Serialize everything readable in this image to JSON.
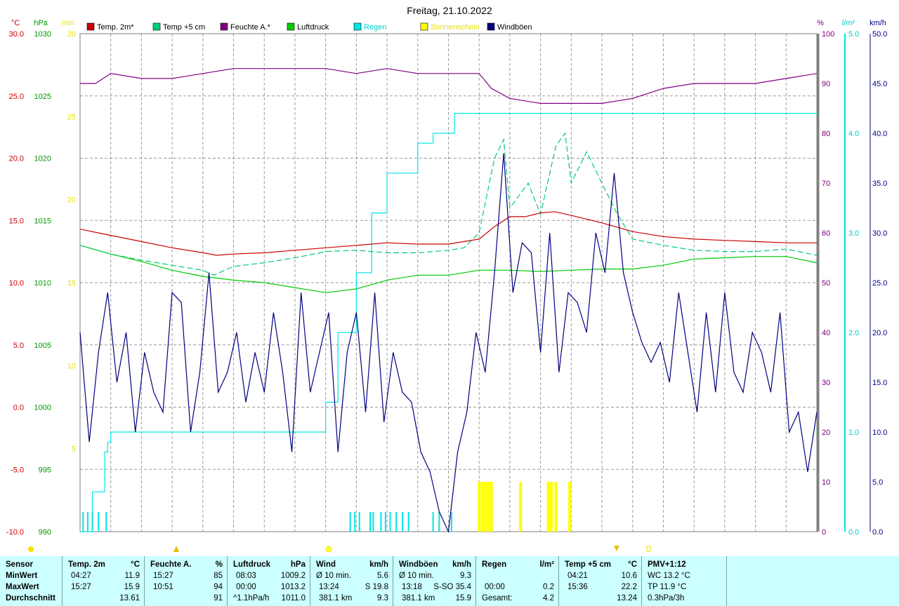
{
  "chart_data": {
    "type": "line",
    "title": "Freitag, 21.10.2022",
    "legend": [
      {
        "name": "Temp. 2m*",
        "color": "#cc0000"
      },
      {
        "name": "Temp +5 cm",
        "color": "#00cc77"
      },
      {
        "name": "Feuchte A.*",
        "color": "#800080"
      },
      {
        "name": "Luftdruck",
        "color": "#00cc00"
      },
      {
        "name": "Regen",
        "color": "#00e5e5"
      },
      {
        "name": "Sonnenschein",
        "color": "#ffff00"
      },
      {
        "name": "Windböen",
        "color": "#000080"
      }
    ],
    "axes": {
      "temp": {
        "unit": "°C",
        "color": "#cc0000",
        "range": [
          -10,
          30
        ],
        "ticks": [
          "30.0",
          "25.0",
          "20.0",
          "15.0",
          "10.0",
          "5.0",
          "0.0",
          "-5.0",
          "-10.0"
        ]
      },
      "pressure": {
        "unit": "hPa",
        "color": "#009900",
        "range": [
          990,
          1030
        ],
        "ticks": [
          "1030",
          "1025",
          "1020",
          "1015",
          "1010",
          "1005",
          "1000",
          "995",
          "990"
        ]
      },
      "sun": {
        "unit": "min",
        "color": "#e5e500",
        "range": [
          0,
          30
        ],
        "ticks": [
          "30",
          "25",
          "20",
          "15",
          "10",
          "5"
        ]
      },
      "humidity": {
        "unit": "%",
        "color": "#800080",
        "range": [
          0,
          100
        ],
        "ticks": [
          "100",
          "90",
          "80",
          "70",
          "60",
          "50",
          "40",
          "30",
          "20",
          "10",
          "0"
        ]
      },
      "rain": {
        "unit": "l/m²",
        "color": "#00cccc",
        "range": [
          0,
          5
        ],
        "ticks": [
          "5.0",
          "4.0",
          "3.0",
          "2.0",
          "1.0",
          "0.0"
        ]
      },
      "wind": {
        "unit": "km/h",
        "color": "#000080",
        "range": [
          0,
          50
        ],
        "ticks": [
          "50.0",
          "45.0",
          "40.0",
          "35.0",
          "30.0",
          "25.0",
          "20.0",
          "15.0",
          "10.0",
          "5.0",
          "0.0"
        ]
      }
    },
    "x_range_hours": [
      0,
      24
    ],
    "grid": true,
    "series": {
      "temp2m": {
        "axis": "temp",
        "x": [
          0,
          1,
          2,
          3,
          4,
          4.45,
          5,
          6,
          7,
          8,
          9,
          10,
          11,
          12,
          13,
          13.5,
          14,
          14.5,
          15,
          15.45,
          16,
          17,
          18,
          19,
          20,
          21,
          22,
          23,
          24
        ],
        "values": [
          14.3,
          13.8,
          13.3,
          12.8,
          12.4,
          12.2,
          12.3,
          12.4,
          12.6,
          12.8,
          13.0,
          13.2,
          13.1,
          13.1,
          13.5,
          14.5,
          15.3,
          15.3,
          15.6,
          15.7,
          15.4,
          14.8,
          14.1,
          13.7,
          13.5,
          13.4,
          13.3,
          13.2,
          13.2
        ]
      },
      "temp5cm": {
        "axis": "temp",
        "x": [
          0,
          1,
          2,
          3,
          4,
          4.35,
          5,
          6,
          7,
          8,
          9,
          10,
          11,
          12,
          12.5,
          13,
          13.5,
          13.8,
          14,
          14.3,
          14.6,
          15,
          15.5,
          15.8,
          16,
          16.5,
          17,
          17.5,
          18,
          19,
          20,
          21,
          22,
          23,
          24
        ],
        "values": [
          13.0,
          12.3,
          11.8,
          11.4,
          11.0,
          10.6,
          11.3,
          11.6,
          12.0,
          12.5,
          12.6,
          12.4,
          12.4,
          12.6,
          12.8,
          14.0,
          20.0,
          21.5,
          16.0,
          17.0,
          18.0,
          15.5,
          21.0,
          22.0,
          18.0,
          20.5,
          18.0,
          15.5,
          13.5,
          13.0,
          12.6,
          12.5,
          12.5,
          12.7,
          12.2
        ]
      },
      "humidity": {
        "axis": "humidity",
        "x": [
          0,
          0.5,
          1,
          2,
          3,
          4,
          5,
          6,
          7,
          8,
          9,
          10,
          11,
          12,
          13,
          13.4,
          14,
          15,
          16,
          17,
          18,
          19,
          20,
          21,
          22,
          23,
          24
        ],
        "values": [
          90,
          90,
          92,
          91,
          91,
          92,
          93,
          93,
          93,
          93,
          92,
          93,
          92,
          92,
          92,
          89,
          87,
          86,
          86,
          86,
          87,
          89,
          90,
          90,
          90,
          91,
          92
        ]
      },
      "pressure": {
        "axis": "pressure",
        "x": [
          0,
          1,
          2,
          3,
          4,
          5,
          6,
          7,
          8,
          9,
          10,
          11,
          12,
          13,
          14,
          15,
          16,
          17,
          18,
          19,
          20,
          21,
          22,
          23,
          24
        ],
        "values": [
          1013.0,
          1012.3,
          1011.7,
          1011.0,
          1010.5,
          1010.2,
          1010.0,
          1009.6,
          1009.2,
          1009.5,
          1010.2,
          1010.6,
          1010.6,
          1011.0,
          1011.0,
          1010.9,
          1011.0,
          1011.1,
          1011.1,
          1011.4,
          1011.9,
          1012.0,
          1012.1,
          1012.1,
          1011.6
        ]
      },
      "rain_cumulative": {
        "axis": "rain",
        "x": [
          0,
          0.4,
          0.8,
          0.9,
          1,
          3,
          4,
          5,
          6,
          7,
          7.2,
          8,
          8.4,
          9,
          9.5,
          10,
          10.5,
          11,
          11.5,
          12,
          12.2,
          24
        ],
        "values": [
          0,
          0.4,
          0.8,
          0.9,
          1.0,
          1.0,
          1.0,
          1.0,
          1.0,
          1.0,
          1.0,
          1.3,
          2.0,
          2.6,
          3.2,
          3.6,
          3.6,
          3.9,
          4.0,
          4.0,
          4.2,
          4.2
        ]
      },
      "windgust": {
        "axis": "wind",
        "x": [
          0,
          0.3,
          0.6,
          0.9,
          1.2,
          1.5,
          1.8,
          2.1,
          2.4,
          2.7,
          3,
          3.3,
          3.6,
          3.9,
          4.2,
          4.5,
          4.8,
          5.1,
          5.4,
          5.7,
          6,
          6.3,
          6.6,
          6.9,
          7.2,
          7.5,
          7.8,
          8.1,
          8.4,
          8.7,
          9,
          9.3,
          9.6,
          9.9,
          10.2,
          10.5,
          10.8,
          11.1,
          11.4,
          11.7,
          12,
          12.3,
          12.6,
          12.9,
          13.2,
          13.5,
          13.8,
          14.1,
          14.4,
          14.7,
          15,
          15.3,
          15.6,
          15.9,
          16.2,
          16.5,
          16.8,
          17.1,
          17.4,
          17.7,
          18,
          18.3,
          18.6,
          18.9,
          19.2,
          19.5,
          19.8,
          20.1,
          20.4,
          20.7,
          21,
          21.3,
          21.6,
          21.9,
          22.2,
          22.5,
          22.8,
          23.1,
          23.4,
          23.7,
          24
        ],
        "values": [
          20,
          9,
          18,
          24,
          15,
          20,
          10,
          18,
          14,
          12,
          24,
          23,
          10,
          16,
          26,
          14,
          16,
          20,
          13,
          18,
          14,
          22,
          16,
          8,
          24,
          14,
          18,
          22,
          8,
          18,
          22,
          12,
          24,
          11,
          18,
          14,
          13,
          8,
          6,
          2,
          0,
          8,
          12,
          20,
          16,
          26,
          38,
          24,
          29,
          28,
          18,
          30,
          16,
          24,
          23,
          20,
          30,
          26,
          36,
          26,
          22,
          19,
          17,
          19,
          15,
          24,
          18,
          12,
          22,
          14,
          24,
          16,
          14,
          20,
          18,
          14,
          22,
          10,
          12,
          6,
          12
        ]
      },
      "sunshine_min": {
        "axis": "sun",
        "bars": [
          {
            "x": 13.0,
            "value": 3
          },
          {
            "x": 13.1,
            "value": 3
          },
          {
            "x": 13.2,
            "value": 3
          },
          {
            "x": 13.3,
            "value": 3
          },
          {
            "x": 13.4,
            "value": 3
          },
          {
            "x": 14.35,
            "value": 3
          },
          {
            "x": 15.25,
            "value": 3
          },
          {
            "x": 15.35,
            "value": 3
          },
          {
            "x": 15.5,
            "value": 3
          },
          {
            "x": 15.95,
            "value": 3
          }
        ]
      },
      "rain_marks": {
        "axis": "rain",
        "x": [
          0.1,
          0.25,
          0.4,
          0.6,
          0.85,
          8.8,
          8.95,
          9.1,
          9.45,
          9.55,
          9.8,
          9.95,
          10.1,
          10.3,
          10.5,
          10.7,
          11.5,
          11.7,
          12.1
        ]
      }
    }
  },
  "summary": {
    "sensor": {
      "header": "Sensor",
      "rows": [
        "MinWert",
        "MaxWert",
        "Durchschnitt"
      ]
    },
    "temp2m": {
      "header": "Temp. 2m",
      "unit": "°C",
      "min_time": "04:27",
      "min": "11.9",
      "max_time": "15:27",
      "max": "15.9",
      "avg": "13.61"
    },
    "feuchte": {
      "header": "Feuchte A.",
      "unit": "%",
      "min_time": "15:27",
      "min": "85",
      "max_time": "10:51",
      "max": "94",
      "avg": "91"
    },
    "luftdruck": {
      "header": "Luftdruck",
      "unit": "hPa",
      "min_time": "08:03",
      "min": "1009.2",
      "max_time": "00:00",
      "max": "1013.2",
      "trend": "^1.1hPa/h",
      "avg": "1011.0"
    },
    "wind": {
      "header": "Wind",
      "unit": "km/h",
      "r1_label": "Ø 10 min.",
      "r1_val": "5.6",
      "r2_time": "13:24",
      "r2_dir": "S 19.8",
      "r3_dist": "381.1 km",
      "r3_val": "9.3"
    },
    "windboen": {
      "header": "Windböen",
      "unit": "km/h",
      "r1_label": "Ø 10 min.",
      "r1_val": "9.3",
      "r2_time": "13:18",
      "r2_dir": "S-SO 35.4",
      "r3_dist": "381.1 km",
      "r3_val": "15.9"
    },
    "regen": {
      "header": "Regen",
      "unit": "l/m²",
      "r2_time": "00:00",
      "r2_val": "0.2",
      "r3_label": "Gesamt:",
      "r3_val": "4.2"
    },
    "temp5cm": {
      "header": "Temp +5 cm",
      "unit": "°C",
      "min_time": "04:21",
      "min": "10.6",
      "max_time": "15:36",
      "max": "22.2",
      "avg": "13.24"
    },
    "pmv": {
      "header": "PMV+1:12",
      "r1": "WC 13.2 °C",
      "r2": "TP 11.9 °C",
      "r3": "0.3hPa/3h"
    }
  }
}
